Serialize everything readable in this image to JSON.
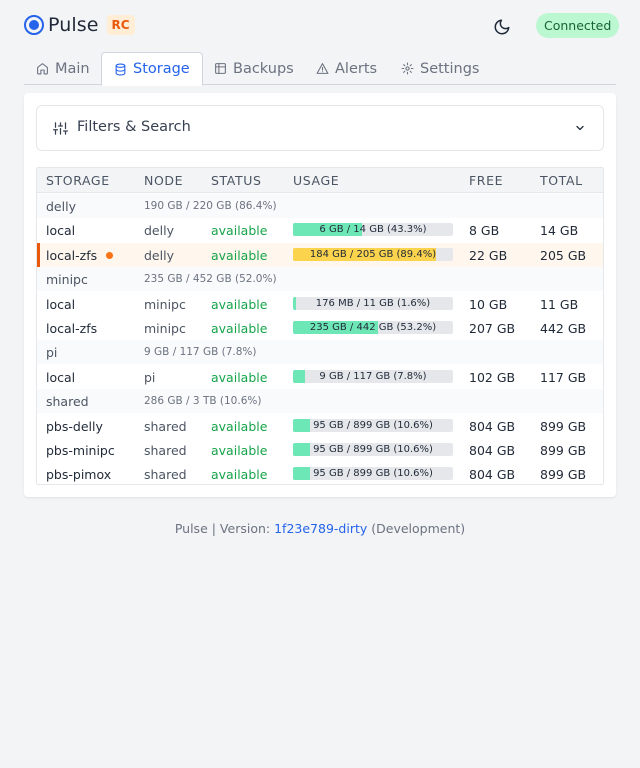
{
  "app": {
    "name": "Pulse",
    "badge": "RC",
    "connection": "Connected",
    "theme_icon": "moon-icon"
  },
  "tabs": [
    {
      "label": "Main",
      "icon": "home-icon",
      "active": false
    },
    {
      "label": "Storage",
      "icon": "database-icon",
      "active": true
    },
    {
      "label": "Backups",
      "icon": "archive-icon",
      "active": false
    },
    {
      "label": "Alerts",
      "icon": "warning-icon",
      "active": false
    },
    {
      "label": "Settings",
      "icon": "gear-icon",
      "active": false
    }
  ],
  "filters": {
    "label": "Filters & Search",
    "icon": "sliders-icon",
    "toggle_icon": "chevron-down-icon"
  },
  "table": {
    "columns": [
      "STORAGE",
      "NODE",
      "STATUS",
      "USAGE",
      "FREE",
      "TOTAL"
    ],
    "groups": [
      {
        "name": "delly",
        "usage": "190 GB / 220 GB (86.4%)",
        "rows": [
          {
            "storage": "local",
            "node": "delly",
            "status": "available",
            "usage_pct": 43.3,
            "usage_text": "6 GB / 14 GB (43.3%)",
            "free": "8 GB",
            "total": "14 GB",
            "alert": false
          },
          {
            "storage": "local-zfs",
            "node": "delly",
            "status": "available",
            "usage_pct": 89.4,
            "usage_text": "184 GB / 205 GB (89.4%)",
            "free": "22 GB",
            "total": "205 GB",
            "alert": true
          }
        ]
      },
      {
        "name": "minipc",
        "usage": "235 GB / 452 GB (52.0%)",
        "rows": [
          {
            "storage": "local",
            "node": "minipc",
            "status": "available",
            "usage_pct": 1.6,
            "usage_text": "176 MB / 11 GB (1.6%)",
            "free": "10 GB",
            "total": "11 GB",
            "alert": false
          },
          {
            "storage": "local-zfs",
            "node": "minipc",
            "status": "available",
            "usage_pct": 53.2,
            "usage_text": "235 GB / 442 GB (53.2%)",
            "free": "207 GB",
            "total": "442 GB",
            "alert": false
          }
        ]
      },
      {
        "name": "pi",
        "usage": "9 GB / 117 GB (7.8%)",
        "rows": [
          {
            "storage": "local",
            "node": "pi",
            "status": "available",
            "usage_pct": 7.8,
            "usage_text": "9 GB / 117 GB (7.8%)",
            "free": "102 GB",
            "total": "117 GB",
            "alert": false
          }
        ]
      },
      {
        "name": "shared",
        "usage": "286 GB / 3 TB (10.6%)",
        "rows": [
          {
            "storage": "pbs-delly",
            "node": "shared",
            "status": "available",
            "usage_pct": 10.6,
            "usage_text": "95 GB / 899 GB (10.6%)",
            "free": "804 GB",
            "total": "899 GB",
            "alert": false
          },
          {
            "storage": "pbs-minipc",
            "node": "shared",
            "status": "available",
            "usage_pct": 10.6,
            "usage_text": "95 GB / 899 GB (10.6%)",
            "free": "804 GB",
            "total": "899 GB",
            "alert": false
          },
          {
            "storage": "pbs-pimox",
            "node": "shared",
            "status": "available",
            "usage_pct": 10.6,
            "usage_text": "95 GB / 899 GB (10.6%)",
            "free": "804 GB",
            "total": "899 GB",
            "alert": false
          }
        ]
      }
    ]
  },
  "colors": {
    "accent": "#2563eb",
    "usage_ok": "#6ee7b7",
    "usage_warn": "#fcd34d",
    "alert": "#ea580c",
    "available": "#16a34a"
  },
  "footer": {
    "prefix": "Pulse | Version:",
    "version": "1f23e789-dirty",
    "suffix": "(Development)"
  }
}
